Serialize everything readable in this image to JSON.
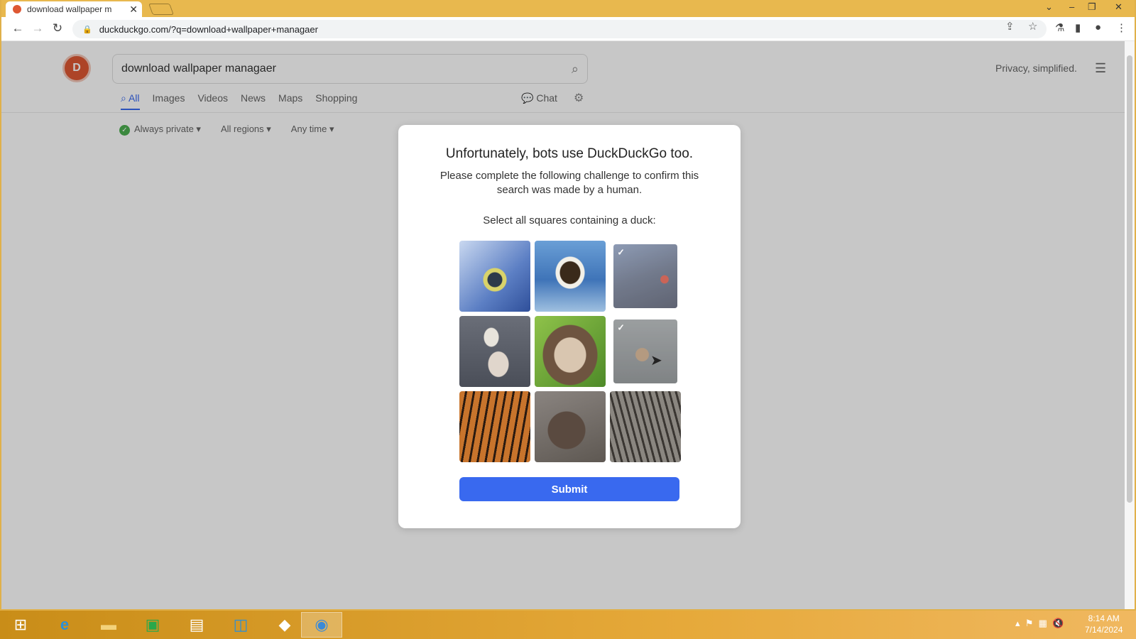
{
  "browser": {
    "tab_title": "download wallpaper m",
    "tab_close": "✕",
    "url": "duckduckgo.com/?q=download+wallpaper+managaer"
  },
  "ddg": {
    "search_query": "download wallpaper managaer",
    "privacy_tagline": "Privacy, simplified.",
    "tabs": [
      "All",
      "Images",
      "Videos",
      "News",
      "Maps",
      "Shopping"
    ],
    "chat": "Chat",
    "filters": [
      "Always private",
      "All regions",
      "Any time"
    ]
  },
  "captcha": {
    "title": "Unfortunately, bots use DuckDuckGo too.",
    "subtitle": "Please complete the following challenge to confirm this search was made by a human.",
    "prompt": "Select all squares containing a duck:",
    "submit_label": "Submit",
    "tiles": [
      {
        "subject": "blue-tit-bird",
        "selected": false
      },
      {
        "subject": "eagle",
        "selected": false
      },
      {
        "subject": "duck-on-rocks",
        "selected": true
      },
      {
        "subject": "ducks-on-water",
        "selected": false
      },
      {
        "subject": "monkey",
        "selected": false
      },
      {
        "subject": "duck-swimming",
        "selected": true
      },
      {
        "subject": "tiger",
        "selected": false
      },
      {
        "subject": "seal",
        "selected": false
      },
      {
        "subject": "cat",
        "selected": false
      }
    ]
  },
  "taskbar": {
    "time": "8:14 AM",
    "date": "7/14/2024"
  }
}
